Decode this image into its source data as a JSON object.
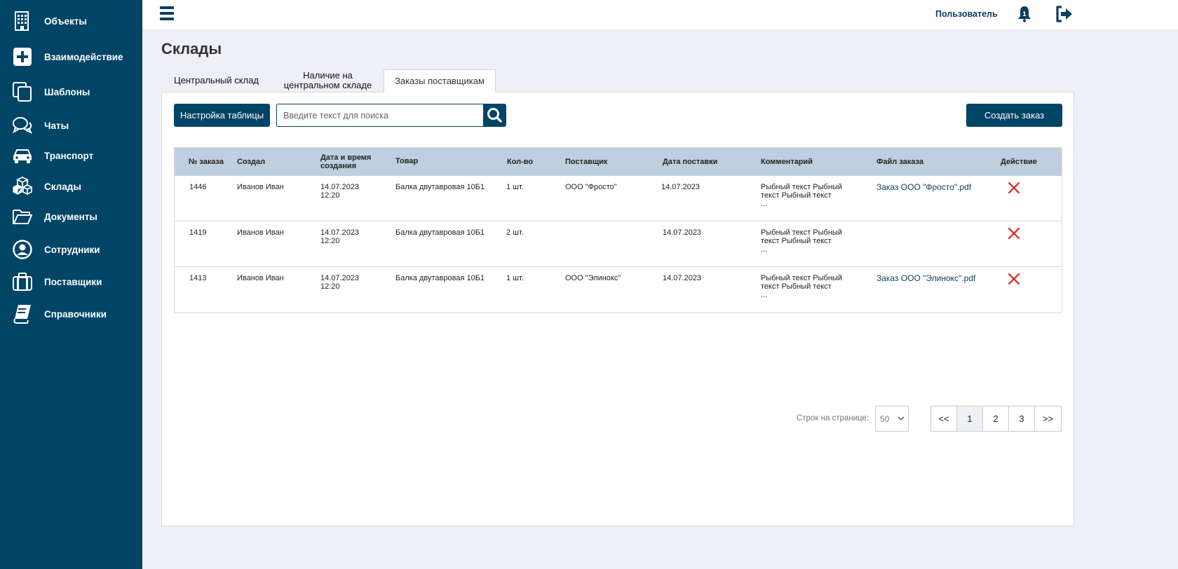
{
  "sidebar": {
    "items": [
      {
        "label": "Объекты",
        "icon": "building-icon"
      },
      {
        "label": "Взаимодействие",
        "icon": "plus-square-icon"
      },
      {
        "label": "Шаблоны",
        "icon": "copy-icon"
      },
      {
        "label": "Чаты",
        "icon": "chat-icon"
      },
      {
        "label": "Транспорт",
        "icon": "car-icon"
      },
      {
        "label": "Склады",
        "icon": "boxes-icon"
      },
      {
        "label": "Документы",
        "icon": "folder-icon"
      },
      {
        "label": "Сотрудники",
        "icon": "user-circle-icon"
      },
      {
        "label": "Поставщики",
        "icon": "briefcase-icon"
      },
      {
        "label": "Справочники",
        "icon": "book-icon"
      }
    ]
  },
  "header": {
    "user_label": "Пользователь"
  },
  "page": {
    "title": "Склады"
  },
  "tabs": [
    {
      "label": "Центральный склад",
      "active": false
    },
    {
      "label": "Наличие на центральном складе",
      "active": false
    },
    {
      "label": "Заказы поставщикам",
      "active": true
    }
  ],
  "toolbar": {
    "table_settings_label": "Настройка таблицы",
    "search_placeholder": "Введите текст для поиска",
    "create_order_label": "Создать заказ"
  },
  "table": {
    "columns": [
      "№ заказа",
      "Создал",
      "Дата и время создания",
      "Товар",
      "Кол-во",
      "Поставщик",
      "Дата поставки",
      "Комментарий",
      "Файл заказа",
      "Действие"
    ],
    "rows": [
      {
        "id": "1446",
        "creator": "Иванов Иван",
        "created_date": "14.07.2023",
        "created_time": "12:20",
        "product": "Балка двутавровая 10Б1",
        "qty": "1 шт.",
        "supplier": "ООО \"Фросто\"",
        "delivery_date": "14.07.2023",
        "comment_1": "Рыбный текст Рыбный",
        "comment_2": "текст Рыбный текст",
        "comment_3": "...",
        "file": "Заказ ООО \"Фросто\".pdf"
      },
      {
        "id": "1419",
        "creator": "Иванов Иван",
        "created_date": "14.07.2023",
        "created_time": "12:20",
        "product": "Балка двутавровая 10Б1",
        "qty": "2 шт.",
        "supplier": "",
        "delivery_date": "14.07.2023",
        "comment_1": "Рыбный текст Рыбный",
        "comment_2": "текст Рыбный текст",
        "comment_3": "...",
        "file": ""
      },
      {
        "id": "1413",
        "creator": "Иванов Иван",
        "created_date": "14.07.2023",
        "created_time": "12:20",
        "product": "Балка двутавровая 10Б1",
        "qty": "1 шт.",
        "supplier": "ООО \"Элинокс\"",
        "delivery_date": "14.07.2023",
        "comment_1": "Рыбный текст Рыбный",
        "comment_2": "текст Рыбный текст",
        "comment_3": "...",
        "file": "Заказ ООО \"Элинокс\".pdf"
      }
    ],
    "delete_color": "#e02020"
  },
  "pagination": {
    "rows_label": "Строк на странице:",
    "rows_per_page": "50",
    "first": "<<",
    "pages": [
      "1",
      "2",
      "3"
    ],
    "current_page": "1",
    "last": ">>"
  },
  "colors": {
    "sidebar_bg": "#004466",
    "accent": "#004466",
    "background": "#eeeff7",
    "table_header": "#bfcfdf"
  }
}
